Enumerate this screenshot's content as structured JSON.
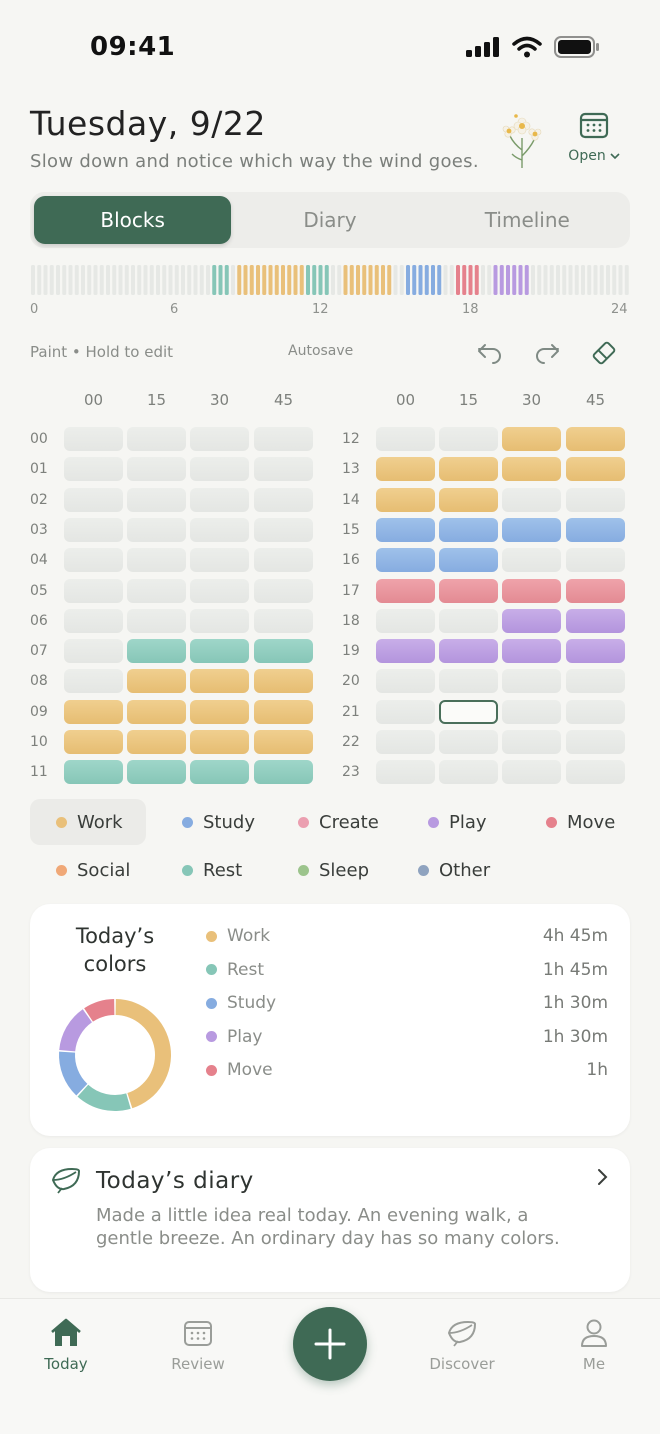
{
  "status": {
    "time": "09:41"
  },
  "header": {
    "date": "Tuesday, 9/22",
    "subtitle": "Slow down and notice which way the wind goes.",
    "open_label": "Open"
  },
  "tabs": [
    "Blocks",
    "Diary",
    "Timeline"
  ],
  "active_tab": 0,
  "strip_ticks": [
    "0",
    "6",
    "12",
    "18",
    "24"
  ],
  "toolbar": {
    "mode": "Paint • Hold to edit",
    "autosave": "Autosave"
  },
  "grid": {
    "minute_headers": [
      "00",
      "15",
      "30",
      "45"
    ],
    "hours_left": [
      "00",
      "01",
      "02",
      "03",
      "04",
      "05",
      "06",
      "07",
      "08",
      "09",
      "10",
      "11"
    ],
    "hours_right": [
      "12",
      "13",
      "14",
      "15",
      "16",
      "17",
      "18",
      "19",
      "20",
      "21",
      "22",
      "23"
    ],
    "blocks": [
      [
        "",
        "",
        "",
        ""
      ],
      [
        "",
        "",
        "",
        ""
      ],
      [
        "",
        "",
        "",
        ""
      ],
      [
        "",
        "",
        "",
        ""
      ],
      [
        "",
        "",
        "",
        ""
      ],
      [
        "",
        "",
        "",
        ""
      ],
      [
        "",
        "",
        "",
        ""
      ],
      [
        "",
        "rest",
        "rest",
        "rest"
      ],
      [
        "",
        "work",
        "work",
        "work"
      ],
      [
        "work",
        "work",
        "work",
        "work"
      ],
      [
        "work",
        "work",
        "work",
        "work"
      ],
      [
        "rest",
        "rest",
        "rest",
        "rest"
      ],
      [
        "",
        "",
        "work",
        "work"
      ],
      [
        "work",
        "work",
        "work",
        "work"
      ],
      [
        "work",
        "work",
        "",
        ""
      ],
      [
        "study",
        "study",
        "study",
        "study"
      ],
      [
        "study",
        "study",
        "",
        ""
      ],
      [
        "move",
        "move",
        "move",
        "move"
      ],
      [
        "",
        "",
        "play",
        "play"
      ],
      [
        "play",
        "play",
        "play",
        "play"
      ],
      [
        "",
        "",
        "",
        ""
      ],
      [
        "",
        "selected",
        "",
        ""
      ],
      [
        "",
        "",
        "",
        ""
      ],
      [
        "",
        "",
        "",
        ""
      ]
    ]
  },
  "categories": [
    {
      "label": "Work",
      "color": "#e9c07a",
      "active": true
    },
    {
      "label": "Study",
      "color": "#86ace0"
    },
    {
      "label": "Create",
      "color": "#eb9fb0"
    },
    {
      "label": "Play",
      "color": "#b89ae0"
    },
    {
      "label": "Move",
      "color": "#e5818c"
    },
    {
      "label": "Social",
      "color": "#f0a877"
    },
    {
      "label": "Rest",
      "color": "#86c6b7"
    },
    {
      "label": "Sleep",
      "color": "#9cc48c"
    },
    {
      "label": "Other",
      "color": "#8fa3bf"
    }
  ],
  "stats": {
    "title_line1": "Today’s",
    "title_line2": "colors",
    "rows": [
      {
        "name": "Work",
        "value": "4h 45m",
        "color": "#e9c07a",
        "minutes": 285
      },
      {
        "name": "Rest",
        "value": "1h 45m",
        "color": "#86c6b7",
        "minutes": 105
      },
      {
        "name": "Study",
        "value": "1h 30m",
        "color": "#86ace0",
        "minutes": 90
      },
      {
        "name": "Play",
        "value": "1h 30m",
        "color": "#b89ae0",
        "minutes": 90
      },
      {
        "name": "Move",
        "value": "1h",
        "color": "#e5818c",
        "minutes": 60
      }
    ]
  },
  "diary": {
    "title": "Today’s diary",
    "text": "Made a little idea real today. An evening walk, a gentle breeze. An ordinary day has so many colors."
  },
  "nav": [
    "Today",
    "Review",
    "Discover",
    "Me"
  ]
}
